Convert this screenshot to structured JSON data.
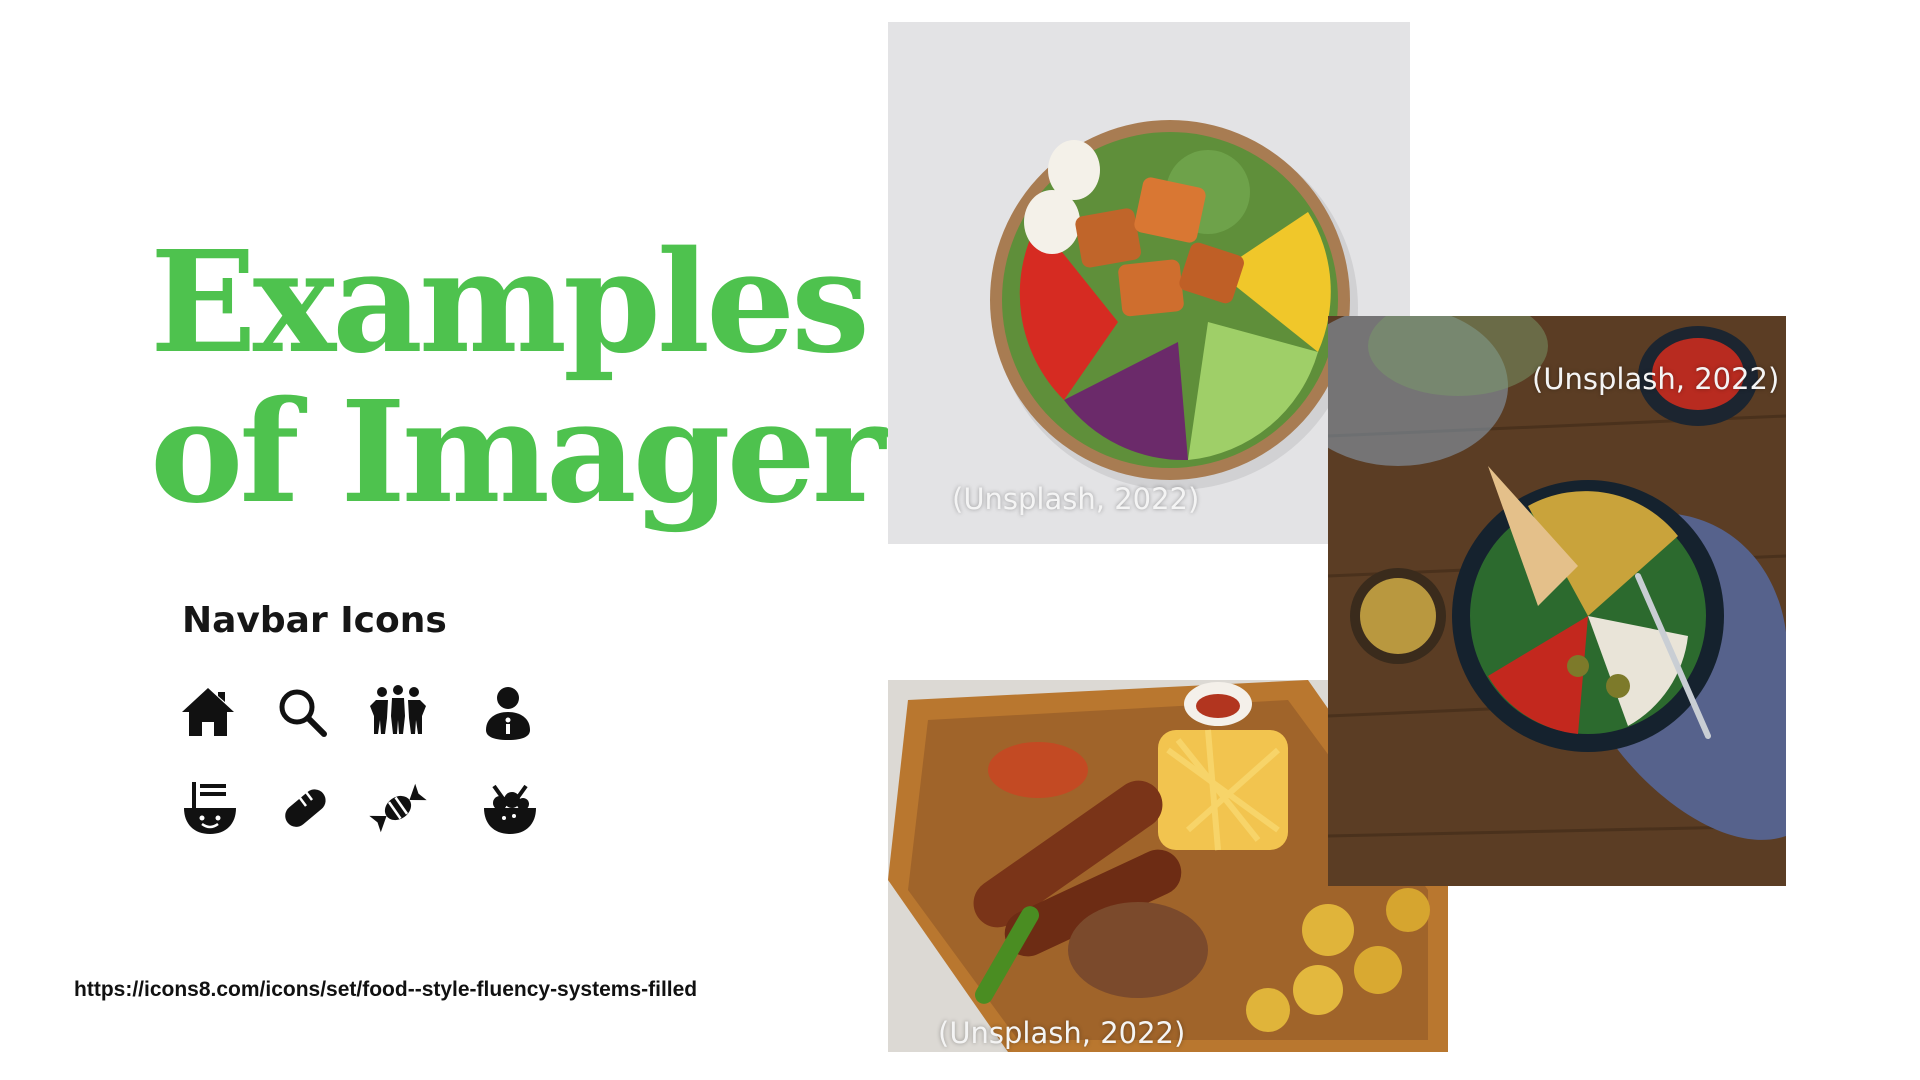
{
  "title": {
    "line1": "Examples",
    "line2": "of Imagery",
    "color": "#4ec24e"
  },
  "navbar": {
    "heading": "Navbar Icons",
    "icons": [
      "home-icon",
      "search-icon",
      "people-icon",
      "user-info-icon",
      "noodle-bowl-icon",
      "bread-icon",
      "candy-icon",
      "salad-bowl-icon"
    ]
  },
  "source_url": "https://icons8.com/icons/set/food--style-fluency-systems-filled",
  "photos": [
    {
      "subject": "salad-bowl-photo",
      "caption": "(Unsplash, 2022)"
    },
    {
      "subject": "buddha-bowl-photo",
      "caption": "(Unsplash, 2022)"
    },
    {
      "subject": "grill-platter-photo",
      "caption": "(Unsplash, 2022)"
    }
  ]
}
